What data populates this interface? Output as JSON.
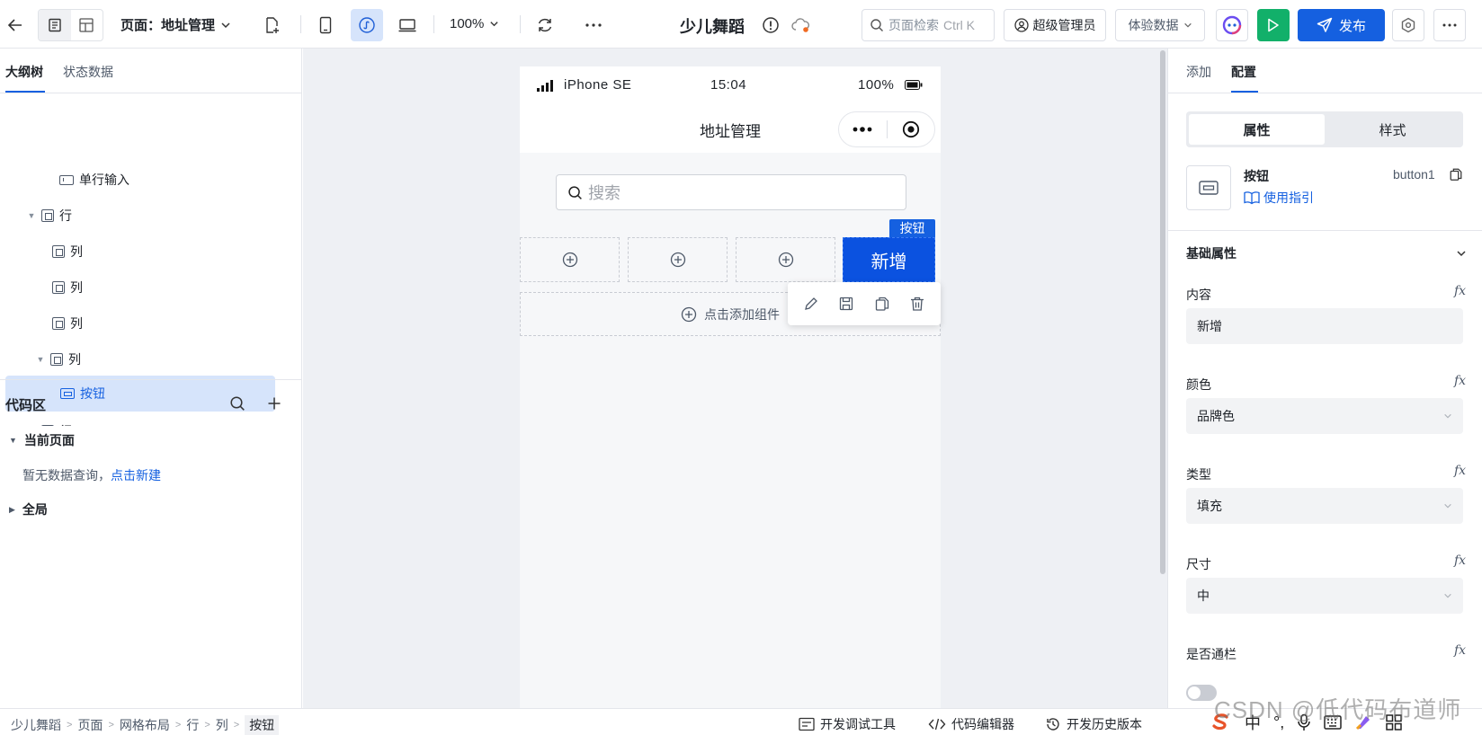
{
  "topbar": {
    "page_selector": "页面：地址管理",
    "zoom": "100%",
    "app_title": "少儿舞蹈",
    "search_placeholder": "页面检索",
    "search_shortcut": "Ctrl K",
    "admin": "超级管理员",
    "data_mode": "体验数据",
    "publish": "发布"
  },
  "left": {
    "tabs": [
      "大纲树",
      "状态数据"
    ],
    "tree": [
      {
        "label": "单行输入",
        "icon": "input-icon"
      },
      {
        "label": "行",
        "icon": "box-icon"
      },
      {
        "label": "列",
        "icon": "box-icon"
      },
      {
        "label": "列",
        "icon": "box-icon"
      },
      {
        "label": "列",
        "icon": "box-icon"
      },
      {
        "label": "列",
        "icon": "box-icon"
      },
      {
        "label": "按钮",
        "icon": "button-icon",
        "selected": true
      },
      {
        "label": "行",
        "icon": "box-icon"
      }
    ],
    "code_area": {
      "title": "代码区",
      "current_page": "当前页面",
      "empty_text": "暂无数据查询，",
      "create_link": "点击新建",
      "global": "全局"
    }
  },
  "canvas": {
    "status_bar": {
      "carrier": "iPhone SE",
      "time": "15:04",
      "battery": "100%"
    },
    "nav_title": "地址管理",
    "search_placeholder": "搜索",
    "add_button": "新增",
    "selected_tag": "按钮",
    "add_component": "点击添加组件"
  },
  "right": {
    "tabs": [
      "添加",
      "配置"
    ],
    "subtabs": [
      "属性",
      "样式"
    ],
    "component": {
      "name": "按钮",
      "id": "button1",
      "guide": "使用指引"
    },
    "section": "基础属性",
    "fields": {
      "content_label": "内容",
      "content_value": "新增",
      "color_label": "颜色",
      "color_value": "品牌色",
      "type_label": "类型",
      "type_value": "填充",
      "size_label": "尺寸",
      "size_value": "中",
      "block_label": "是否通栏"
    },
    "fx": "fx"
  },
  "bottombar": {
    "breadcrumbs": [
      "少儿舞蹈",
      "页面",
      "网格布局",
      "行",
      "列",
      "按钮"
    ],
    "dev_tools": "开发调试工具",
    "code_editor": "代码编辑器",
    "history": "开发历史版本"
  },
  "watermark": "CSDN @低代码布道师",
  "tray": {
    "ime": "中"
  },
  "colors": {
    "brand": "#1560e0",
    "run": "#12b06a",
    "selected_bg": "#d6e4fb"
  }
}
